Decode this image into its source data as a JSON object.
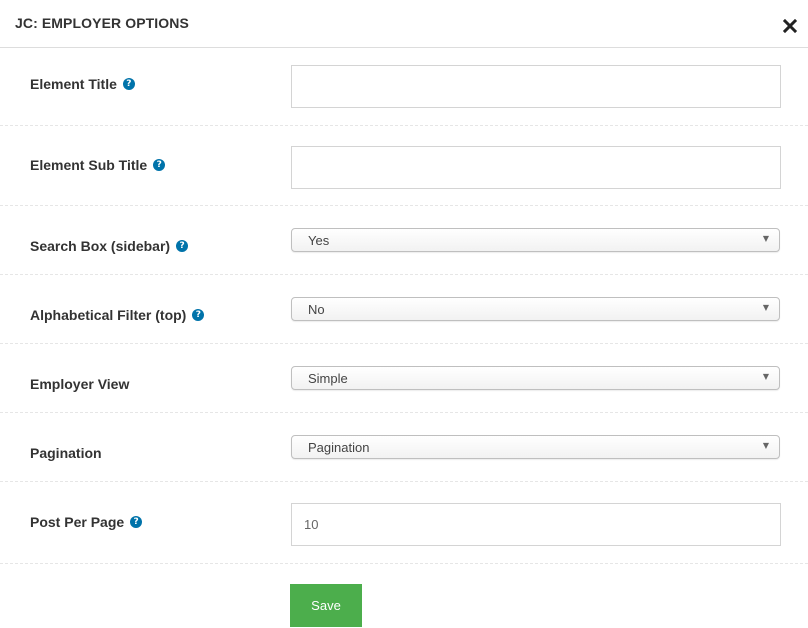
{
  "modal": {
    "title": "JC: EMPLOYER OPTIONS",
    "close_icon": "close-x-icon"
  },
  "fields": {
    "element_title": {
      "label": "Element Title",
      "value": "",
      "placeholder": "",
      "help_icon": "question-circle-icon"
    },
    "element_sub_title": {
      "label": "Element Sub Title",
      "value": "",
      "placeholder": "",
      "help_icon": "question-circle-icon"
    },
    "search_box": {
      "label": "Search Box (sidebar)",
      "value": "Yes",
      "help_icon": "question-circle-icon"
    },
    "alphabetical_filter": {
      "label": "Alphabetical Filter (top)",
      "value": "No",
      "help_icon": "question-circle-icon"
    },
    "employer_view": {
      "label": "Employer View",
      "value": "Simple"
    },
    "pagination": {
      "label": "Pagination",
      "value": "Pagination"
    },
    "post_per_page": {
      "label": "Post Per Page",
      "value": "10",
      "help_icon": "question-circle-icon"
    }
  },
  "actions": {
    "save_label": "Save"
  },
  "colors": {
    "help_icon": "#0073aa",
    "save_button": "#4cae4c"
  }
}
